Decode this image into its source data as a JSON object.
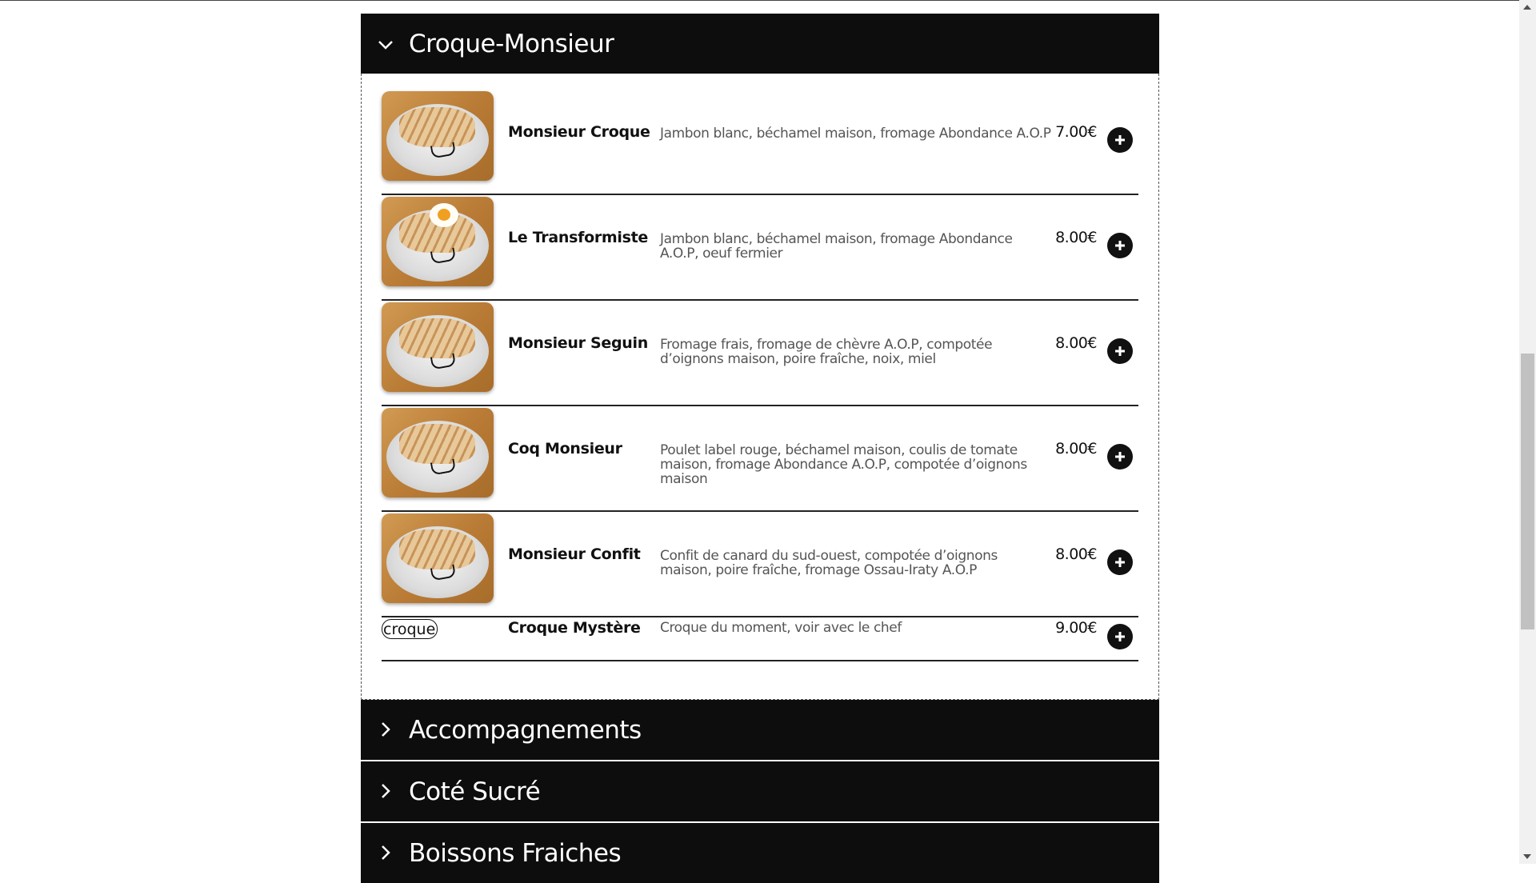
{
  "sections": [
    {
      "title": "Croque-Monsieur",
      "expanded": true,
      "icon": "chevron-down-icon"
    },
    {
      "title": "Accompagnements",
      "expanded": false,
      "icon": "chevron-right-icon"
    },
    {
      "title": "Coté Sucré",
      "expanded": false,
      "icon": "chevron-right-icon"
    },
    {
      "title": "Boissons Fraiches",
      "expanded": false,
      "icon": "chevron-right-icon"
    }
  ],
  "items": [
    {
      "name": "Monsieur Croque",
      "description": "Jambon blanc, béchamel maison, fromage Abondance A.O.P",
      "price": "7.00€"
    },
    {
      "name": "Le Transformiste",
      "description": "Jambon blanc, béchamel maison, fromage Abondance A.O.P, oeuf fermier",
      "price": "8.00€"
    },
    {
      "name": "Monsieur Seguin",
      "description": "Fromage frais, fromage de chèvre A.O.P, compotée d’oignons maison, poire fraîche, noix, miel",
      "price": "8.00€"
    },
    {
      "name": "Coq Monsieur",
      "description": "Poulet label rouge, béchamel maison, coulis de tomate maison, fromage Abondance A.O.P, compotée d’oignons maison",
      "price": "8.00€"
    },
    {
      "name": "Monsieur Confit",
      "description": "Confit de canard du sud-ouest, compotée d’oignons maison, poire fraîche, fromage Ossau-Iraty A.O.P",
      "price": "8.00€"
    },
    {
      "name": "Croque Mystère",
      "description": "Croque du moment, voir avec le chef",
      "price": "9.00€",
      "image_alt": "croque"
    }
  ],
  "colors": {
    "header_bg": "#0d0d0d",
    "text": "#111111",
    "description": "#555555",
    "button_bg": "#111111"
  }
}
